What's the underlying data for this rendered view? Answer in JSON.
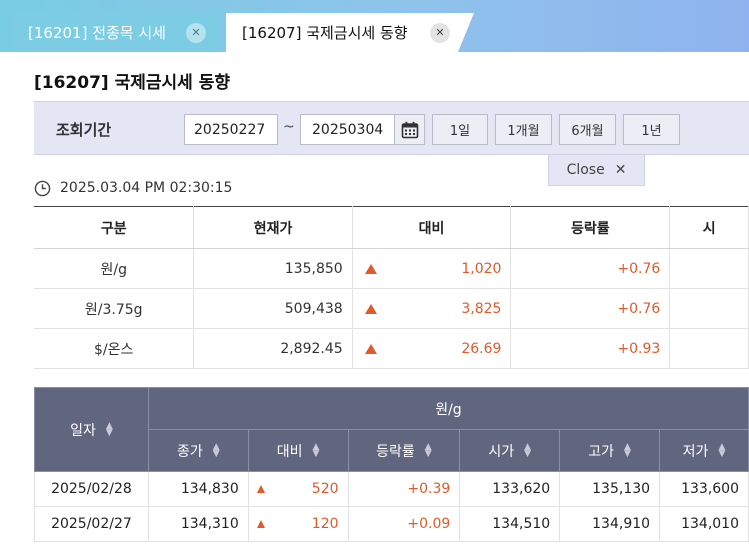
{
  "tabs": [
    {
      "label": "[16201] 전종목 시세",
      "active": false
    },
    {
      "label": "[16207] 국제금시세 동향",
      "active": true
    }
  ],
  "page_title": "[16207] 국제금시세 동향",
  "search": {
    "label": "조회기간",
    "from": "20250227",
    "to": "20250304",
    "separator": "~",
    "periods": [
      "1일",
      "1개월",
      "6개월",
      "1년"
    ],
    "close_label": "Close"
  },
  "timestamp": "2025.03.04 PM 02:30:15",
  "summary": {
    "headers": [
      "구분",
      "현재가",
      "대비",
      "등락률",
      "시"
    ],
    "rows": [
      {
        "unit": "원/g",
        "price": "135,850",
        "diff": "1,020",
        "rate": "+0.76"
      },
      {
        "unit": "원/3.75g",
        "price": "509,438",
        "diff": "3,825",
        "rate": "+0.76"
      },
      {
        "unit": "$/온스",
        "price": "2,892.45",
        "diff": "26.69",
        "rate": "+0.93"
      }
    ]
  },
  "history": {
    "date_header": "일자",
    "group_header": "원/g",
    "sub_headers": [
      "종가",
      "대비",
      "등락률",
      "시가",
      "고가",
      "저가"
    ],
    "rows": [
      {
        "date": "2025/02/28",
        "close": "134,830",
        "diff": "520",
        "rate": "+0.39",
        "open": "133,620",
        "high": "135,130",
        "low": "133,600"
      },
      {
        "date": "2025/02/27",
        "close": "134,310",
        "diff": "120",
        "rate": "+0.09",
        "open": "134,510",
        "high": "134,910",
        "low": "134,010"
      }
    ]
  },
  "colors": {
    "up": "#e05a2a",
    "header_bg": "#61667f",
    "search_bg": "#e4e6f4"
  }
}
